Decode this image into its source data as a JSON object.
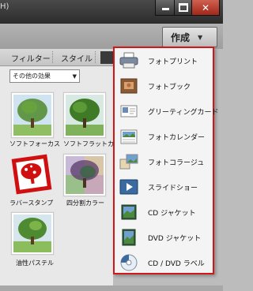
{
  "window": {
    "title_fragment": "H)",
    "minimize_glyph": "",
    "maximize_glyph": "",
    "close_glyph": "✕"
  },
  "toolbar": {
    "create_label": "作成",
    "create_caret": "▼"
  },
  "panel": {
    "tabs": [
      {
        "label": "フィルター"
      },
      {
        "label": "スタイル"
      }
    ],
    "effects_dropdown": {
      "selected": "その他の効果",
      "caret": "▼"
    },
    "effects": [
      {
        "label": "ソフトフォーカス",
        "icon": "tree-icon"
      },
      {
        "label": "ソフトフラットカ...",
        "icon": "tree-icon"
      },
      {
        "label": "ラバースタンプ",
        "icon": "rubber-stamp-tree-icon"
      },
      {
        "label": "四分割カラー",
        "icon": "quad-color-tree-icon"
      },
      {
        "label": "油性パステル",
        "icon": "pastel-tree-icon"
      }
    ]
  },
  "create_menu": {
    "items": [
      {
        "label": "フォトプリント",
        "icon": "printer-icon"
      },
      {
        "label": "フォトブック",
        "icon": "photo-book-icon"
      },
      {
        "label": "グリーティングカード",
        "icon": "greeting-card-icon"
      },
      {
        "label": "フォトカレンダー",
        "icon": "calendar-icon"
      },
      {
        "label": "フォトコラージュ",
        "icon": "collage-icon"
      },
      {
        "label": "スライドショー",
        "icon": "slideshow-icon"
      },
      {
        "label": "CD ジャケット",
        "icon": "cd-jacket-icon"
      },
      {
        "label": "DVD ジャケット",
        "icon": "dvd-jacket-icon"
      },
      {
        "label": "CD / DVD ラベル",
        "icon": "disc-label-icon"
      }
    ]
  }
}
